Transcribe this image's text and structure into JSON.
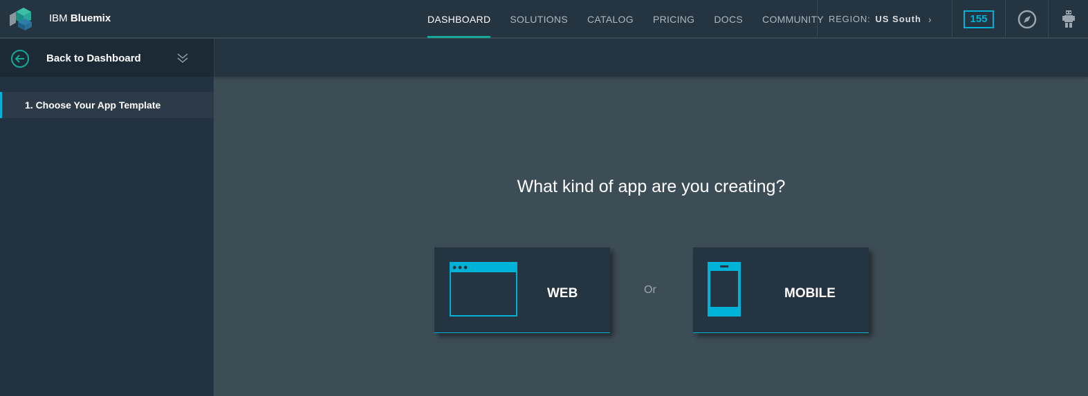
{
  "header": {
    "brand_prefix": "IBM",
    "brand_name": "Bluemix",
    "nav": [
      {
        "label": "DASHBOARD",
        "active": true
      },
      {
        "label": "SOLUTIONS",
        "active": false
      },
      {
        "label": "CATALOG",
        "active": false
      },
      {
        "label": "PRICING",
        "active": false
      },
      {
        "label": "DOCS",
        "active": false
      },
      {
        "label": "COMMUNITY",
        "active": false
      }
    ],
    "region_label": "REGION:",
    "region_value": "US South",
    "notification_count": "155",
    "icons": [
      "bluemix-logo",
      "compass-icon",
      "avatar-icon"
    ]
  },
  "sidebar": {
    "back_label": "Back to Dashboard",
    "steps": [
      {
        "label": "1. Choose Your App Template",
        "active": true
      }
    ]
  },
  "main": {
    "question": "What kind of app are you creating?",
    "separator": "Or",
    "options": [
      {
        "label": "WEB",
        "icon": "browser-window-icon"
      },
      {
        "label": "MOBILE",
        "icon": "mobile-phone-icon"
      }
    ]
  },
  "colors": {
    "accent": "#00b2d6",
    "nav_active": "#16a99a",
    "header_bg": "#253441",
    "content_bg": "#3d4d56"
  }
}
